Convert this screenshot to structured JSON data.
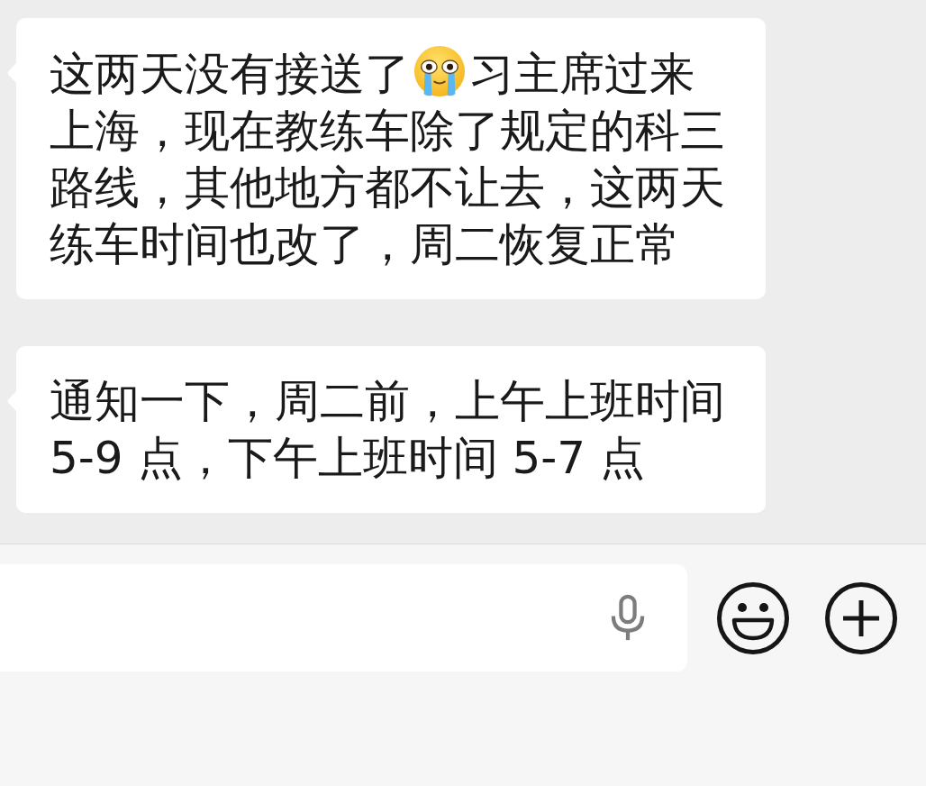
{
  "messages": [
    {
      "parts": [
        {
          "kind": "text",
          "text": "这两天没有接送了"
        },
        {
          "kind": "emoji"
        },
        {
          "kind": "text",
          "text": "习主席过来上海，现在教练车除了规定的科三路线，其他地方都不让去，这两天练车时间也改了，周二恢复正常"
        }
      ]
    },
    {
      "parts": [
        {
          "kind": "text",
          "text": "通知一下，周二前，上午上班时间5-9 点，下午上班时间 5-7 点"
        }
      ]
    }
  ]
}
